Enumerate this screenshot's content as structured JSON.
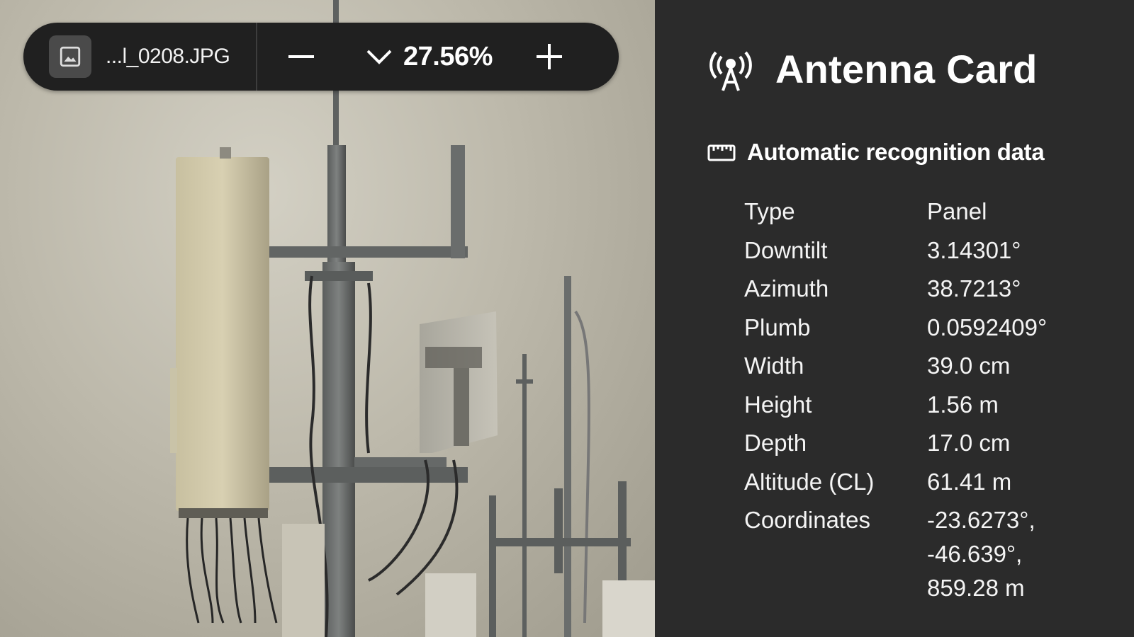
{
  "viewer": {
    "file_name": "...l_0208.JPG",
    "zoom": "27.56%",
    "icons": {
      "file": "image-icon",
      "zoom_out": "minus-icon",
      "zoom_menu": "chevron-down-icon",
      "zoom_in": "plus-icon"
    }
  },
  "panel": {
    "title": "Antenna Card",
    "title_icon": "antenna-tower-icon",
    "section": {
      "title": "Automatic recognition data",
      "icon": "ruler-icon",
      "rows": [
        {
          "key": "Type",
          "value": "Panel"
        },
        {
          "key": "Downtilt",
          "value": "3.14301°"
        },
        {
          "key": "Azimuth",
          "value": "38.7213°"
        },
        {
          "key": "Plumb",
          "value": "0.0592409°"
        },
        {
          "key": "Width",
          "value": "39.0 cm"
        },
        {
          "key": "Height",
          "value": "1.56 m"
        },
        {
          "key": "Depth",
          "value": "17.0 cm"
        },
        {
          "key": "Altitude (CL)",
          "value": "61.41 m"
        }
      ],
      "coordinates": {
        "key": "Coordinates",
        "lat": "-23.6273°,",
        "lon": "-46.639°,",
        "alt": "859.28 m"
      }
    }
  },
  "colors": {
    "panel_bg": "#2b2b2b",
    "toolbar_bg": "#202020",
    "text": "#ffffff"
  }
}
